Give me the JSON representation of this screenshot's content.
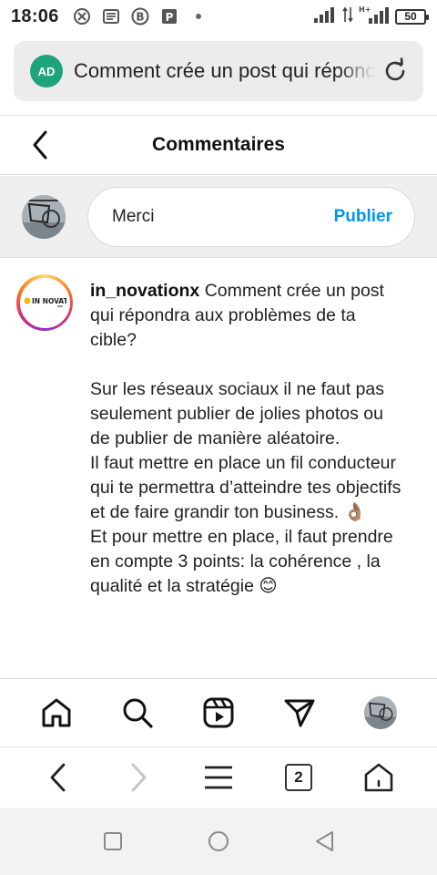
{
  "status_bar": {
    "time": "18:06",
    "battery": "50",
    "network": "H+"
  },
  "browser": {
    "ad_badge": "AD",
    "url_text": "Comment crée un post qui répondra",
    "tabs_count": "2"
  },
  "header": {
    "title": "Commentaires"
  },
  "composer": {
    "value": "Merci",
    "publish_label": "Publier"
  },
  "post": {
    "username": "in_novationx",
    "avatar_logo_text": "IN NOVATION",
    "first_line": " Comment crée un post qui répondra aux problèmes de ta cible?",
    "paragraph_1": "Sur les réseaux sociaux il ne faut pas seulement publier de jolies photos ou de publier de manière aléatoire.",
    "paragraph_2": "Il faut mettre en place un fil conducteur qui te permettra d’atteindre tes objectifs et de faire grandir ton business. 👌🏽",
    "paragraph_3": "Et pour mettre en place, il faut prendre en compte 3 points: la cohérence , la qualité et la stratégie 😊"
  },
  "colors": {
    "accent_blue": "#0095f6",
    "ad_green": "#1fa37a"
  },
  "icons": {
    "tabs": [
      "home-icon",
      "search-icon",
      "reels-icon",
      "send-icon",
      "profile-avatar"
    ],
    "browser_nav": [
      "back-icon",
      "forward-icon",
      "menu-icon",
      "tabs-icon",
      "home-icon"
    ],
    "android_nav": [
      "recents-icon",
      "home-circle-icon",
      "back-triangle-icon"
    ]
  }
}
